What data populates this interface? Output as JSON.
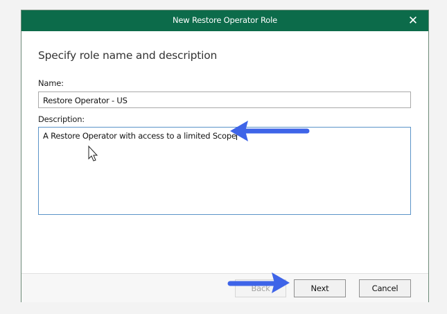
{
  "dialog": {
    "title": "New Restore Operator Role",
    "close_icon": "close-icon",
    "heading": "Specify role name and description",
    "name_label": "Name:",
    "name_value": "Restore Operator - US",
    "description_label": "Description:",
    "description_value": "A Restore Operator with access to a limited Scope",
    "buttons": {
      "back": "Back",
      "next": "Next",
      "cancel": "Cancel"
    }
  },
  "annotations": {
    "arrow_color": "#3e64e8",
    "arrows": [
      "arrow-pointing-left-icon",
      "arrow-pointing-right-icon"
    ],
    "cursor": "mouse-pointer-icon"
  },
  "colors": {
    "titlebar": "#0c6b4a",
    "focus_border": "#5a93c8"
  }
}
